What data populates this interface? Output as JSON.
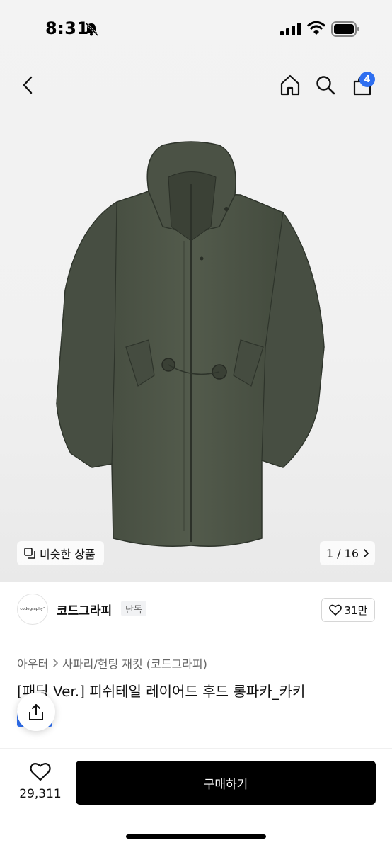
{
  "status_bar": {
    "time": "8:31",
    "icons": [
      "mute-bell-icon",
      "signal-icon",
      "wifi-icon",
      "battery-icon"
    ]
  },
  "nav": {
    "back_icon": "chevron-left-icon",
    "home_icon": "home-icon",
    "search_icon": "search-icon",
    "cart_icon": "cart-icon",
    "cart_badge": "4"
  },
  "gallery": {
    "similar_label": "비슷한 상품",
    "page_indicator": "1 / 16",
    "image_subject": "khaki hooded long parka"
  },
  "brand": {
    "logo_text": "codegraphy°",
    "name": "코드그라피",
    "badge": "단독",
    "likes": "31만"
  },
  "breadcrumb": {
    "category": "아우터",
    "subcategory": "사파리/헌팅 재킷 (코드그라피)"
  },
  "product": {
    "title": "[패딩 Ver.] 피쉬테일 레이어드 후드 롱파카_카키"
  },
  "bottom_bar": {
    "wish_count": "29,311",
    "buy_label": "구매하기"
  },
  "colors": {
    "accent": "#2f6ff0",
    "coat": "#4a5144",
    "buy_button": "#000000"
  }
}
